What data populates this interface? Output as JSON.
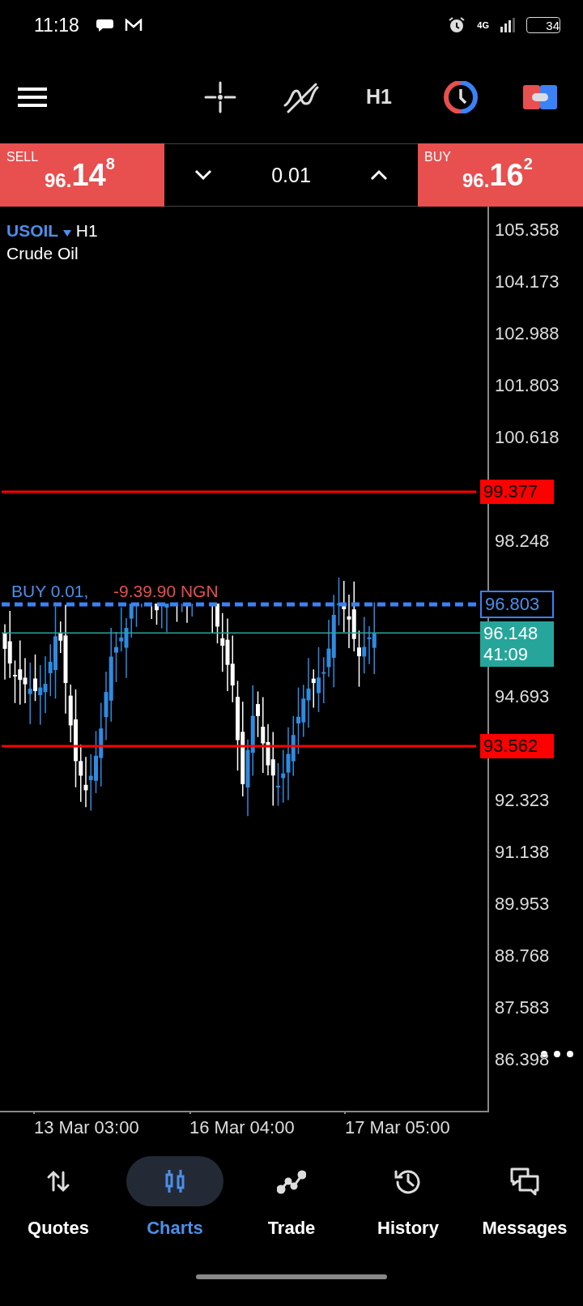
{
  "status_bar": {
    "time": "11:18",
    "network": "4G",
    "battery": "34"
  },
  "toolbar": {
    "timeframe": "H1"
  },
  "trade_panel": {
    "sell": {
      "label": "SELL",
      "price_small": "96.",
      "price_big": "14",
      "price_sup": "8"
    },
    "volume": "0.01",
    "buy": {
      "label": "BUY",
      "price_small": "96.",
      "price_big": "16",
      "price_sup": "2"
    }
  },
  "chart": {
    "symbol": "USOIL",
    "timeframe": "H1",
    "description": "Crude Oil",
    "price_axis": [
      "105.358",
      "104.173",
      "102.988",
      "101.803",
      "100.618",
      "98.248",
      "94.693",
      "92.323",
      "91.138",
      "89.953",
      "88.768",
      "87.583",
      "86.398"
    ],
    "levels": [
      {
        "kind": "level",
        "price": "99.377"
      },
      {
        "kind": "order",
        "price": "96.803",
        "label": "BUY 0.01,",
        "profit": "-9.39.90 NGN"
      },
      {
        "kind": "bid",
        "price": "96.148",
        "countdown": "41:09"
      },
      {
        "kind": "level",
        "price": "93.562"
      }
    ],
    "time_axis": [
      "13 Mar 03:00",
      "16 Mar 04:00",
      "17 Mar 05:00"
    ]
  },
  "nav": [
    {
      "label": "Quotes",
      "selected": false
    },
    {
      "label": "Charts",
      "selected": true
    },
    {
      "label": "Trade",
      "selected": false
    },
    {
      "label": "History",
      "selected": false
    },
    {
      "label": "Messages",
      "selected": false
    }
  ]
}
